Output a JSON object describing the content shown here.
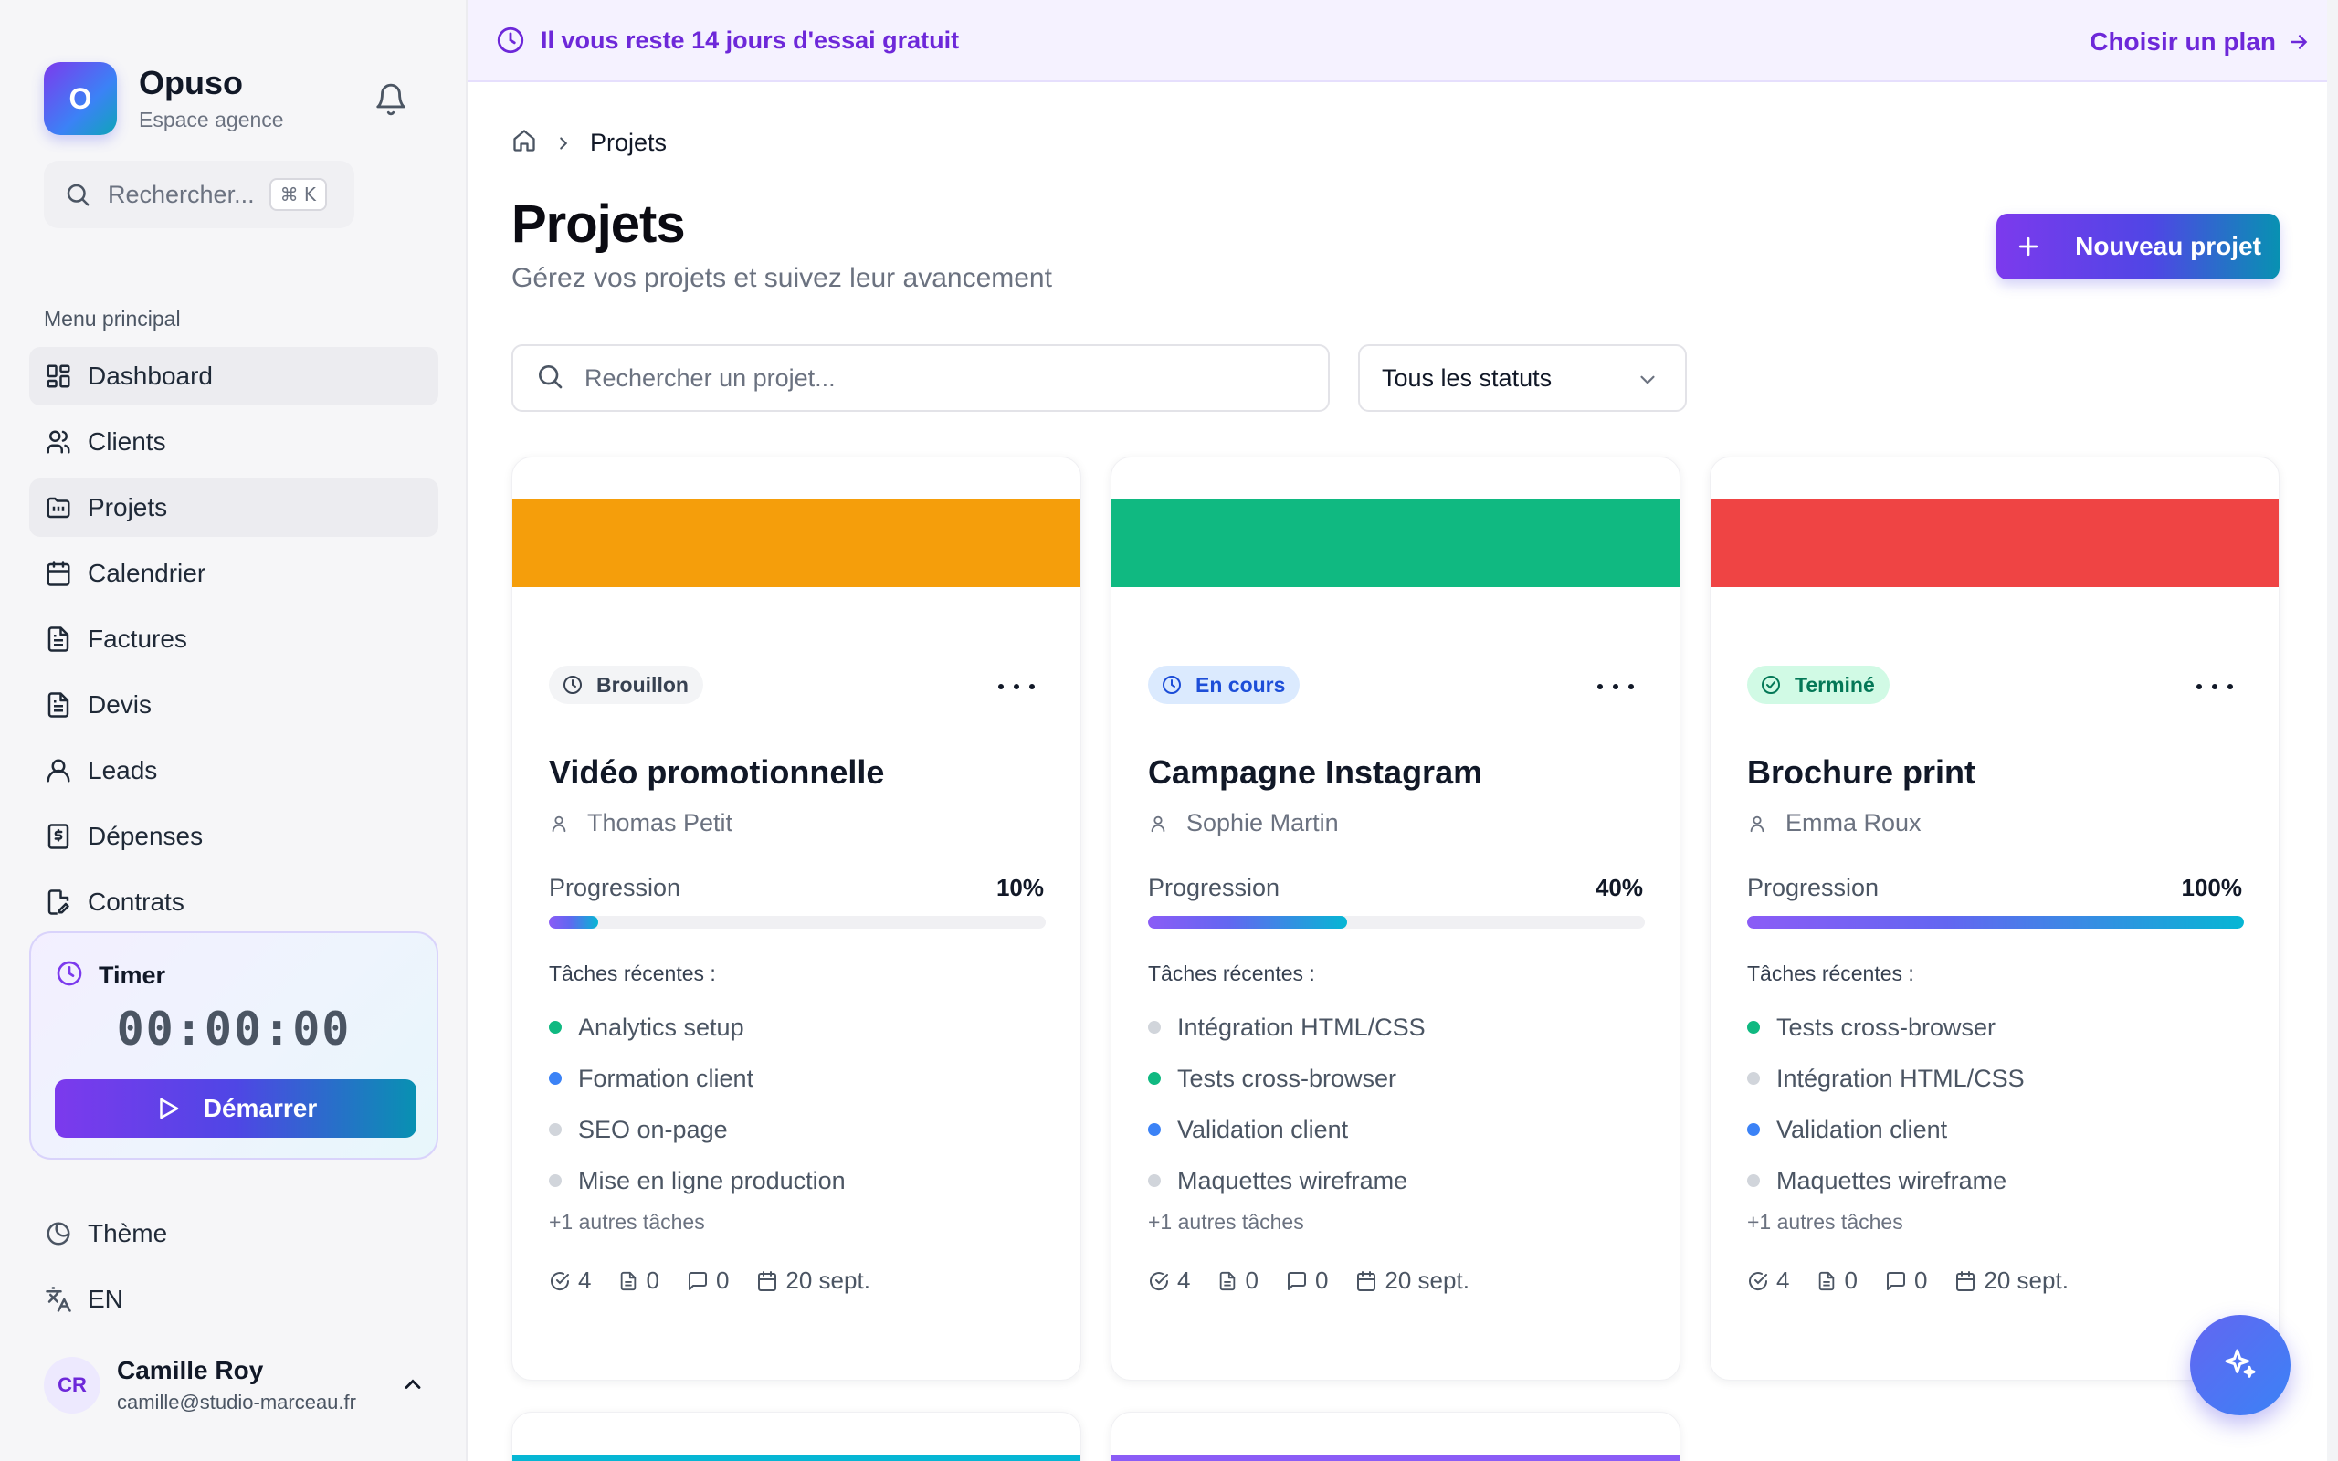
{
  "brand": {
    "name": "Opuso",
    "subtitle": "Espace agence",
    "logo_letter": "O"
  },
  "sidebar": {
    "search_placeholder": "Rechercher...",
    "search_shortcut": "⌘ K",
    "menu_title": "Menu principal",
    "items": [
      {
        "label": "Dashboard",
        "icon": "grid-icon",
        "active": true
      },
      {
        "label": "Clients",
        "icon": "users-icon",
        "active": false
      },
      {
        "label": "Projets",
        "icon": "folder-icon",
        "active": true
      },
      {
        "label": "Calendrier",
        "icon": "calendar-icon",
        "active": false
      },
      {
        "label": "Factures",
        "icon": "document-icon",
        "active": false
      },
      {
        "label": "Devis",
        "icon": "document-icon",
        "active": false
      },
      {
        "label": "Leads",
        "icon": "user-icon",
        "active": false
      },
      {
        "label": "Dépenses",
        "icon": "receipt-icon",
        "active": false
      },
      {
        "label": "Contrats",
        "icon": "contract-icon",
        "active": false
      }
    ],
    "timer": {
      "label": "Timer",
      "time": "00:00:00",
      "button": "Démarrer"
    },
    "theme_label": "Thème",
    "language_label": "EN",
    "user": {
      "initials": "CR",
      "name": "Camille Roy",
      "email": "camille@studio-marceau.fr"
    }
  },
  "trial": {
    "message": "Il vous reste 14 jours d'essai gratuit",
    "cta": "Choisir un plan"
  },
  "breadcrumb": {
    "current": "Projets"
  },
  "page": {
    "title": "Projets",
    "subtitle": "Gérez vos projets et suivez leur avancement",
    "new_button": "Nouveau projet",
    "search_placeholder": "Rechercher un projet...",
    "status_filter": "Tous les statuts"
  },
  "colors": {
    "accent": "#7c3aed",
    "accent_end": "#0891b2",
    "draft_cover": "#f59e0b",
    "in_progress_cover": "#10b981",
    "done_cover": "#ef4444",
    "dot_green": "#10b981",
    "dot_blue": "#3b82f6",
    "dot_gray": "#d1d5db"
  },
  "projects": [
    {
      "status": "Brouillon",
      "title": "Vidéo promotionnelle",
      "client": "Thomas Petit",
      "progress_label": "Progression",
      "progress": 10,
      "progress_text": "10%",
      "tasks_label": "Tâches récentes :",
      "tasks": [
        {
          "label": "Analytics setup",
          "state": "done"
        },
        {
          "label": "Formation client",
          "state": "in_progress"
        },
        {
          "label": "SEO on-page",
          "state": "todo"
        },
        {
          "label": "Mise en ligne production",
          "state": "todo"
        }
      ],
      "more_tasks": "+1 autres tâches",
      "stats": {
        "tasks": "4",
        "files": "0",
        "comments": "0",
        "date": "20 sept."
      }
    },
    {
      "status": "En cours",
      "title": "Campagne Instagram",
      "client": "Sophie Martin",
      "progress_label": "Progression",
      "progress": 40,
      "progress_text": "40%",
      "tasks_label": "Tâches récentes :",
      "tasks": [
        {
          "label": "Intégration HTML/CSS",
          "state": "todo"
        },
        {
          "label": "Tests cross-browser",
          "state": "done"
        },
        {
          "label": "Validation client",
          "state": "in_progress"
        },
        {
          "label": "Maquettes wireframe",
          "state": "todo"
        }
      ],
      "more_tasks": "+1 autres tâches",
      "stats": {
        "tasks": "4",
        "files": "0",
        "comments": "0",
        "date": "20 sept."
      }
    },
    {
      "status": "Terminé",
      "title": "Brochure print",
      "client": "Emma Roux",
      "progress_label": "Progression",
      "progress": 100,
      "progress_text": "100%",
      "tasks_label": "Tâches récentes :",
      "tasks": [
        {
          "label": "Tests cross-browser",
          "state": "done"
        },
        {
          "label": "Intégration HTML/CSS",
          "state": "todo"
        },
        {
          "label": "Validation client",
          "state": "in_progress"
        },
        {
          "label": "Maquettes wireframe",
          "state": "todo"
        }
      ],
      "more_tasks": "+1 autres tâches",
      "stats": {
        "tasks": "4",
        "files": "0",
        "comments": "0",
        "date": "20 sept."
      }
    }
  ]
}
